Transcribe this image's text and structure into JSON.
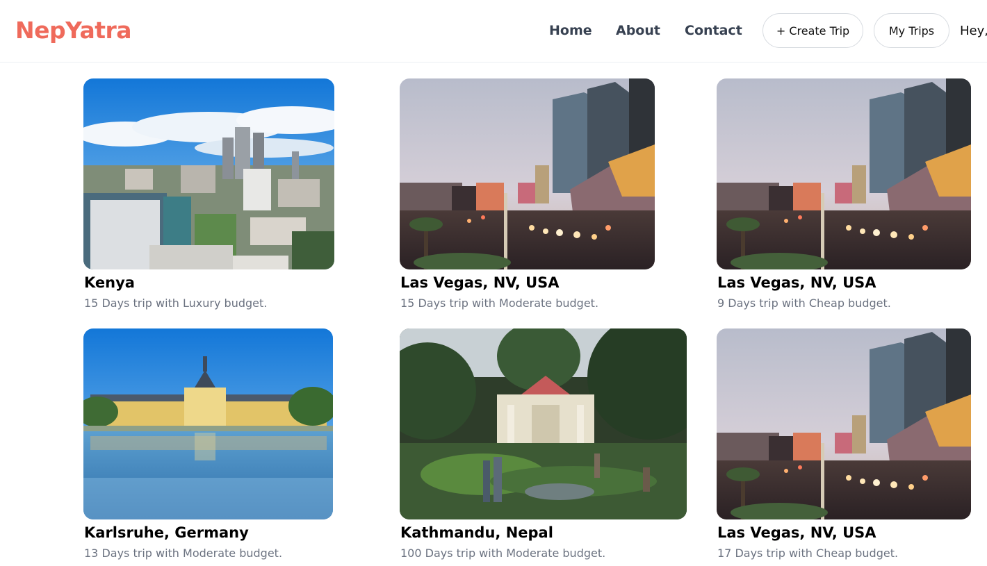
{
  "header": {
    "logo": "NepYatra",
    "nav": {
      "home": "Home",
      "about": "About",
      "contact": "Contact"
    },
    "create_trip_label": "+ Create Trip",
    "my_trips_label": "My Trips",
    "greeting": "Hey,"
  },
  "trips": [
    {
      "title": "Kenya",
      "subtitle": "15 Days trip with Luxury budget.",
      "image": "nairobi-skyline-photo"
    },
    {
      "title": "Las Vegas, NV, USA",
      "subtitle": "15 Days trip with Moderate budget.",
      "image": "las-vegas-strip-photo"
    },
    {
      "title": "Las Vegas, NV, USA",
      "subtitle": "9 Days trip with Cheap budget.",
      "image": "las-vegas-strip-photo"
    },
    {
      "title": "Karlsruhe, Germany",
      "subtitle": "13 Days trip with Moderate budget.",
      "image": "karlsruhe-palace-photo"
    },
    {
      "title": "Kathmandu, Nepal",
      "subtitle": "100 Days trip with Moderate budget.",
      "image": "kathmandu-garden-photo"
    },
    {
      "title": "Las Vegas, NV, USA",
      "subtitle": "17 Days trip with Cheap budget.",
      "image": "las-vegas-strip-photo"
    }
  ]
}
